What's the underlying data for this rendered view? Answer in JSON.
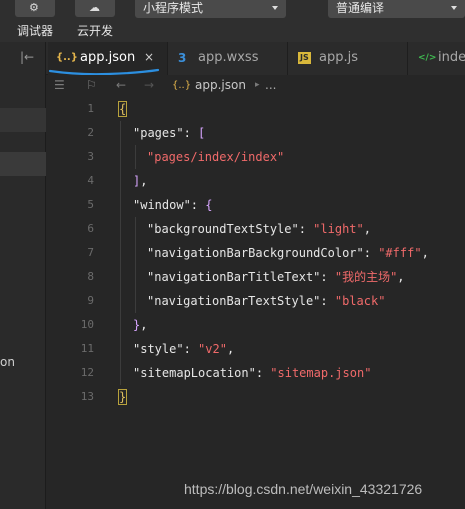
{
  "toolbar": {
    "debugger_label": "调试器",
    "cloud_label": "云开发",
    "mode_select": "小程序模式",
    "compile_select": "普通编译"
  },
  "sidebar": {
    "partial_text": "on"
  },
  "tabs": [
    {
      "label": "app.json",
      "icon": "{..}",
      "active": true,
      "close": "×"
    },
    {
      "label": "app.wxss",
      "icon": "3",
      "active": false
    },
    {
      "label": "app.js",
      "icon": "JS",
      "active": false
    },
    {
      "label": "inde",
      "icon": "</>",
      "active": false
    }
  ],
  "breadcrumb": {
    "icon": "{..}",
    "file": "app.json",
    "separator": "▸",
    "more": "..."
  },
  "code": {
    "line_numbers": [
      "1",
      "2",
      "3",
      "4",
      "5",
      "6",
      "7",
      "8",
      "9",
      "10",
      "11",
      "12",
      "13"
    ],
    "l1": "{",
    "l2_key": "\"pages\"",
    "l2_colon": ": ",
    "l2_bracket": "[",
    "l3_str": "\"pages/index/index\"",
    "l4_bracket": "]",
    "l4_comma": ",",
    "l5_key": "\"window\"",
    "l5_colon": ": ",
    "l5_brace": "{",
    "l6_key": "\"backgroundTextStyle\"",
    "l6_colon": ": ",
    "l6_val": "\"light\"",
    "l6_comma": ",",
    "l7_key": "\"navigationBarBackgroundColor\"",
    "l7_colon": ": ",
    "l7_val": "\"#fff\"",
    "l7_comma": ",",
    "l8_key": "\"navigationBarTitleText\"",
    "l8_colon": ": ",
    "l8_val": "\"我的主场\"",
    "l8_comma": ",",
    "l9_key": "\"navigationBarTextStyle\"",
    "l9_colon": ": ",
    "l9_val": "\"black\"",
    "l10_brace": "}",
    "l10_comma": ",",
    "l11_key": "\"style\"",
    "l11_colon": ": ",
    "l11_val": "\"v2\"",
    "l11_comma": ",",
    "l12_key": "\"sitemapLocation\"",
    "l12_colon": ": ",
    "l12_val": "\"sitemap.json\"",
    "l13": "}"
  },
  "watermark": "https://blog.csdn.net/weixin_43321726",
  "colors": {
    "json_icon": "#e5b64c",
    "wxss_icon": "#3b8fd9",
    "js_icon": "#d9b83b",
    "wxml_icon": "#3fb950",
    "string": "#f06a6a",
    "bracket": "#d7a5ff",
    "underline": "#2c8fe0"
  }
}
